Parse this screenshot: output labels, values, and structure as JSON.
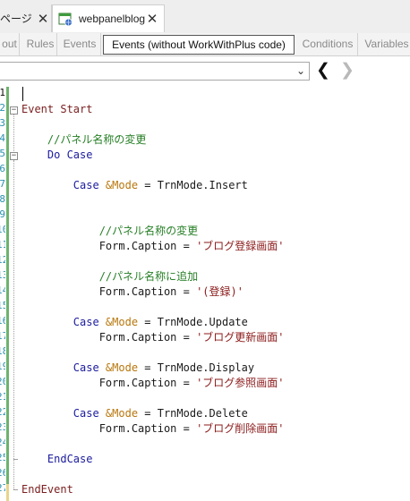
{
  "tabs": [
    {
      "label": "ページ",
      "close": "✕",
      "icon": "",
      "active": false
    },
    {
      "label": "webpanelblog",
      "close": "✕",
      "icon": "webpanel-icon",
      "active": true
    }
  ],
  "parts": [
    "out",
    "Rules",
    "Events",
    "Events (without WorkWithPlus code)",
    "Conditions",
    "Variables"
  ],
  "navigator": {
    "value": "",
    "back": "❮",
    "forward": "❯"
  },
  "line_numbers": [
    "1",
    "2",
    "3",
    "4",
    "5",
    "6",
    "7",
    "8",
    "9",
    "10",
    "11",
    "12",
    "13",
    "14",
    "15",
    "16",
    "17",
    "18",
    "19",
    "20",
    "21",
    "22",
    "23",
    "24",
    "25",
    "26",
    "27"
  ],
  "lines": [
    [],
    [
      {
        "t": "Event Start",
        "c": "kw2"
      }
    ],
    [],
    [
      {
        "t": "    //パネル名称の変更",
        "c": "cm"
      }
    ],
    [
      {
        "t": "    Do Case",
        "c": "kw"
      }
    ],
    [],
    [
      {
        "t": "        Case ",
        "c": "kw"
      },
      {
        "t": "&Mode",
        "c": "var"
      },
      {
        "t": " = TrnMode.Insert",
        "c": "txt"
      }
    ],
    [],
    [],
    [
      {
        "t": "            //パネル名称の変更",
        "c": "cm"
      }
    ],
    [
      {
        "t": "            Form.Caption = ",
        "c": "txt"
      },
      {
        "t": "'ブログ登録画面'",
        "c": "str"
      }
    ],
    [],
    [
      {
        "t": "            //パネル名称に追加",
        "c": "cm"
      }
    ],
    [
      {
        "t": "            Form.Caption = ",
        "c": "txt"
      },
      {
        "t": "'(登録)'",
        "c": "str"
      }
    ],
    [],
    [
      {
        "t": "        Case ",
        "c": "kw"
      },
      {
        "t": "&Mode",
        "c": "var"
      },
      {
        "t": " = TrnMode.Update",
        "c": "txt"
      }
    ],
    [
      {
        "t": "            Form.Caption = ",
        "c": "txt"
      },
      {
        "t": "'ブログ更新画面'",
        "c": "str"
      }
    ],
    [],
    [
      {
        "t": "        Case ",
        "c": "kw"
      },
      {
        "t": "&Mode",
        "c": "var"
      },
      {
        "t": " = TrnMode.Display",
        "c": "txt"
      }
    ],
    [
      {
        "t": "            Form.Caption = ",
        "c": "txt"
      },
      {
        "t": "'ブログ参照画面'",
        "c": "str"
      }
    ],
    [],
    [
      {
        "t": "        Case ",
        "c": "kw"
      },
      {
        "t": "&Mode",
        "c": "var"
      },
      {
        "t": " = TrnMode.Delete",
        "c": "txt"
      }
    ],
    [
      {
        "t": "            Form.Caption = ",
        "c": "txt"
      },
      {
        "t": "'ブログ削除画面'",
        "c": "str"
      }
    ],
    [],
    [
      {
        "t": "    EndCase",
        "c": "kw"
      }
    ],
    [],
    [
      {
        "t": "EndEvent",
        "c": "kw2"
      }
    ]
  ],
  "colors": {
    "keyword": "#1b1b9e",
    "event_keyword": "#7a1e1e",
    "comment": "#267f26",
    "variable": "#b8760b",
    "string": "#8b1a1a",
    "line_number": "#2b91af",
    "change_bar": "#6db36d"
  }
}
